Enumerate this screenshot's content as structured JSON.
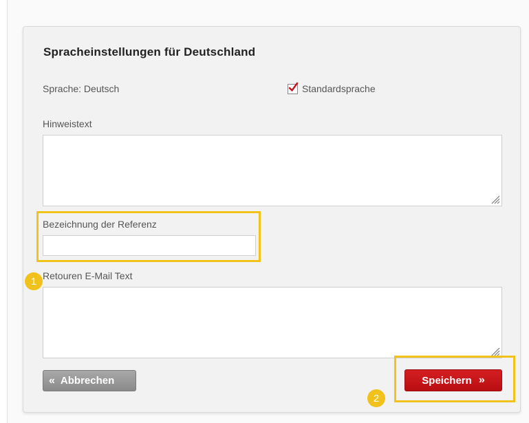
{
  "form": {
    "title": "Spracheinstellungen für Deutschland",
    "language_label": "Sprache: Deutsch",
    "default_language": {
      "label": "Standardsprache",
      "checked": true
    },
    "hint_label": "Hinweistext",
    "hint_value": "",
    "reference_label": "Bezeichnung der Referenz",
    "reference_value": "",
    "returns_email_label": "Retouren E-Mail Text",
    "returns_email_value": ""
  },
  "buttons": {
    "cancel_icon": "«",
    "cancel_label": "Abbrechen",
    "save_label": "Speichern",
    "save_icon": "»"
  },
  "annotations": {
    "badge_1": "1",
    "badge_2": "2"
  },
  "colors": {
    "accent_red": "#c4121a",
    "highlight_yellow": "#f1c21b",
    "checkmark_red": "#c4121a"
  }
}
